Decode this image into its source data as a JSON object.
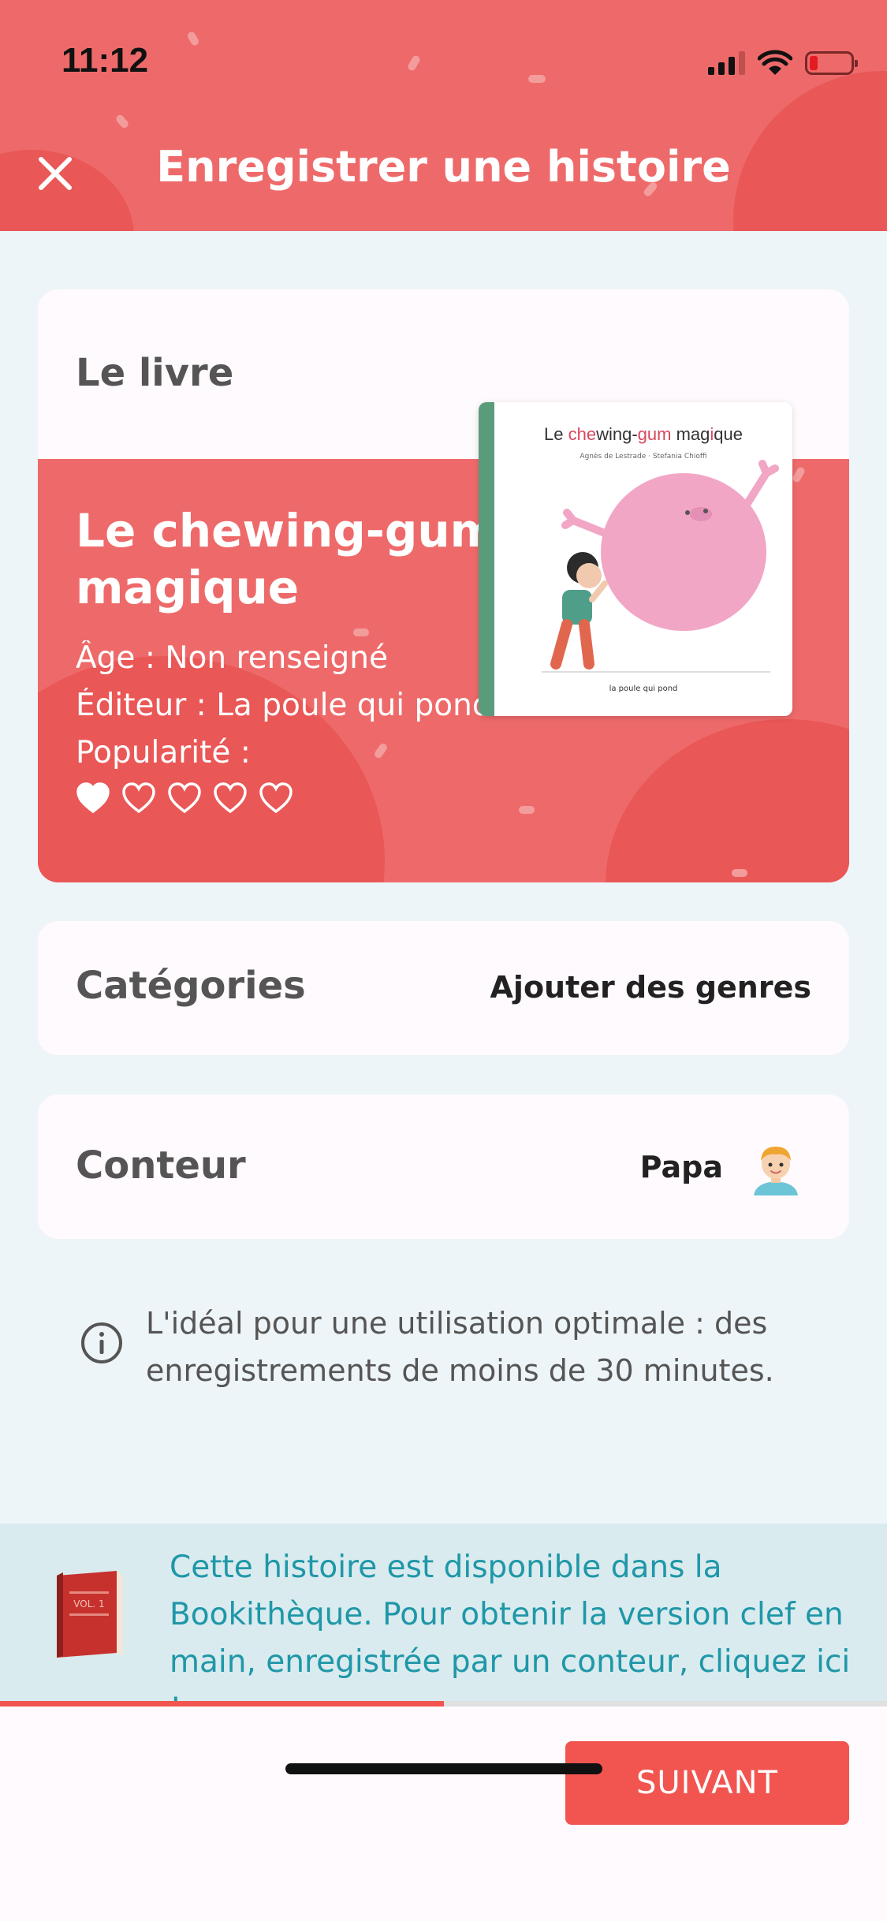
{
  "status_bar": {
    "time": "11:12"
  },
  "header": {
    "title": "Enregistrer une histoire"
  },
  "book_section": {
    "heading": "Le livre",
    "title": "Le chewing-gum magique",
    "age": "Âge : Non renseigné",
    "publisher": "Éditeur : La poule qui pond",
    "popularity_label": "Popularité :",
    "popularity_rating": 1,
    "popularity_max": 5,
    "cover": {
      "title_prefix": "Le ",
      "title_red1": "che",
      "title_mid1": "wing-",
      "title_red2": "gum",
      "title_mid2": " mag",
      "title_red3": "i",
      "title_end": "que",
      "authors": "Agnès de Lestrade · Stefania Chioffi",
      "publisher": "la poule qui pond"
    }
  },
  "categories": {
    "label": "Catégories",
    "action": "Ajouter des genres"
  },
  "storyteller": {
    "label": "Conteur",
    "value": "Papa"
  },
  "info": {
    "text": "L'idéal pour une utilisation optimale : des enregistrements de moins de 30 minutes."
  },
  "promo": {
    "text": "Cette histoire est disponible dans la Bookithèque. Pour obtenir la version clef en main, enregistrée par un conteur, cliquez ici !",
    "book_label": "VOL. 1"
  },
  "progress": {
    "fraction": 0.5
  },
  "footer": {
    "next_label": "SUIVANT"
  },
  "colors": {
    "accent": "#f25550",
    "header": "#ee6a6a",
    "promo_text": "#1f97a8"
  },
  "icons": [
    "close-icon",
    "info-icon",
    "heart-icon",
    "avatar-icon",
    "book-icon",
    "wifi-icon",
    "signal-icon",
    "battery-icon"
  ]
}
